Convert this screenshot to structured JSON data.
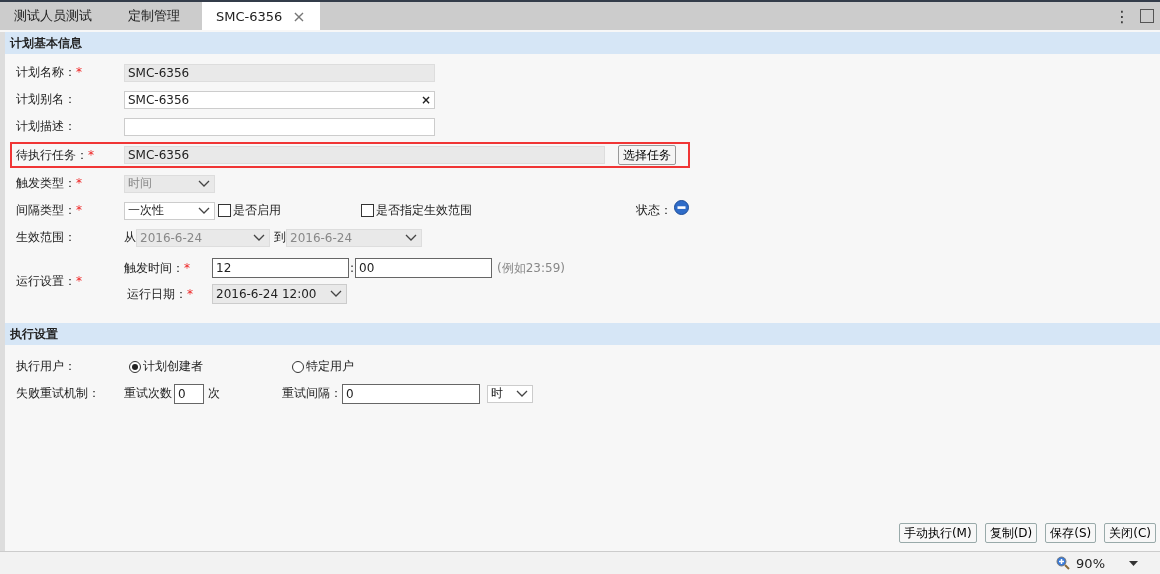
{
  "tabs": [
    {
      "label": "测试人员测试",
      "selected": false
    },
    {
      "label": "定制管理",
      "selected": false
    },
    {
      "label": "SMC-6356",
      "selected": true,
      "close": "×"
    }
  ],
  "tab_menu": "⋮",
  "basic": {
    "title": "计划基本信息",
    "plan_name": {
      "label": "计划名称：",
      "mark": "*",
      "value": "SMC-6356",
      "disabled": true
    },
    "plan_alias": {
      "label": "计划别名：",
      "value": "SMC-6356",
      "clear": "×"
    },
    "plan_desc": {
      "label": "计划描述："
    },
    "task": {
      "label": "待执行任务：",
      "mark": "*",
      "value": "SMC-6356",
      "highlighted": true,
      "button": "选择任务"
    },
    "trigger_type": {
      "label": "触发类型：",
      "mark": "*",
      "value": "时间",
      "disabled": true
    },
    "interval_type": {
      "label": "间隔类型：",
      "mark": "*",
      "value": "一次性"
    },
    "enable": {
      "label": "是否启用",
      "checked": false
    },
    "specify_range": {
      "label": "是否指定生效范围",
      "checked": false
    },
    "status": {
      "label": "状态："
    },
    "effective_range": {
      "label": "生效范围：",
      "from_label": "从",
      "from": "2016-6-24",
      "to_label": "到",
      "to": "2016-6-24",
      "disabled": true
    },
    "run_settings": {
      "label": "运行设置：",
      "mark": "*",
      "trigger_time_label": "触发时间：",
      "trigger_time_mark": "*",
      "hour": "12",
      "separator": ":",
      "minute": "00",
      "hint": "(例如23:59)",
      "run_date_label": "运行日期：",
      "run_date_mark": "*",
      "run_date": "2016-6-24 12:00"
    }
  },
  "execution": {
    "title": "执行设置",
    "user_label": "执行用户：",
    "user_options": [
      {
        "label": "计划创建者",
        "selected": true
      },
      {
        "label": "特定用户",
        "selected": false
      }
    ],
    "retry_label": "失败重试机制：",
    "retry_count_label": "重试次数",
    "retry_count": "0",
    "retry_count_unit": "次",
    "retry_interval_label": "重试间隔：",
    "retry_interval": "0",
    "retry_unit": "时"
  },
  "buttons": [
    "手动执行(M)",
    "复制(D)",
    "保存(S)",
    "关闭(C)"
  ],
  "status_bar": {
    "zoom": "90%"
  }
}
